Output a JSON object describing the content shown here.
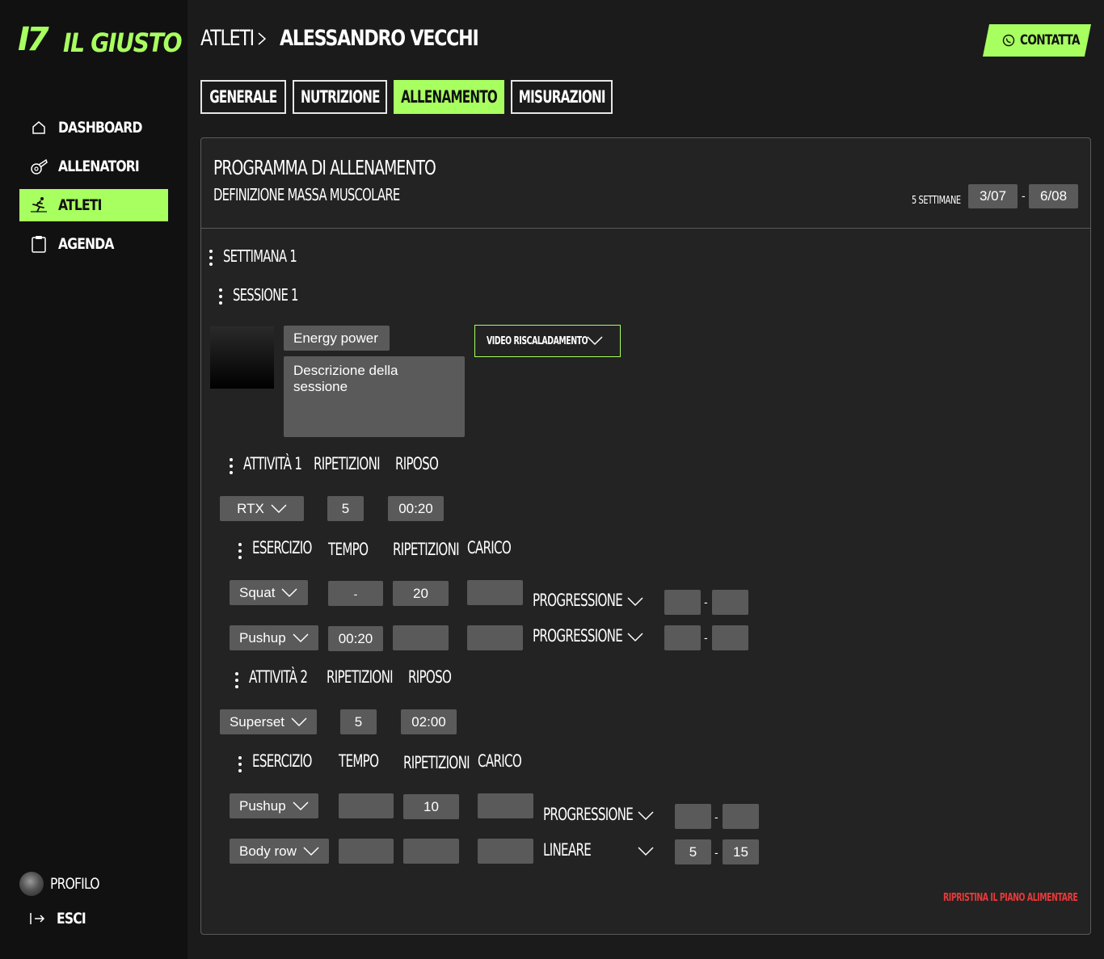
{
  "brand": {
    "mark": "I7",
    "name": "IL GIUSTO"
  },
  "sidebar": {
    "items": [
      {
        "label": "DASHBOARD",
        "icon": "home-icon",
        "active": false
      },
      {
        "label": "ALLENATORI",
        "icon": "whistle-icon",
        "active": false
      },
      {
        "label": "ATLETI",
        "icon": "runner-icon",
        "active": true
      },
      {
        "label": "AGENDA",
        "icon": "clipboard-icon",
        "active": false
      }
    ],
    "profile_label": "PROFILO",
    "logout_label": "ESCI"
  },
  "header": {
    "breadcrumb_root": "ATLETI",
    "breadcrumb_current": "ALESSANDRO VECCHI",
    "contact_label": "CONTATTA"
  },
  "tabs": [
    {
      "label": "GENERALE",
      "active": false
    },
    {
      "label": "NUTRIZIONE",
      "active": false
    },
    {
      "label": "ALLENAMENTO",
      "active": true
    },
    {
      "label": "MISURAZIONI",
      "active": false
    }
  ],
  "program": {
    "title": "PROGRAMMA DI ALLENAMENTO",
    "subtitle": "DEFINIZIONE MASSA MUSCOLARE",
    "weeks_label": "5 SETTIMANE",
    "start_date": "3/07",
    "date_separator": "-",
    "end_date": "6/08"
  },
  "week": {
    "label": "SETTIMANA 1",
    "session": {
      "label": "SESSIONE 1",
      "name": "Energy power",
      "description_placeholder": "Descrizione della sessione",
      "video_label": "VIDEO RISCALADAMENTO",
      "activities": [
        {
          "label": "ATTIVITÀ 1",
          "reps_header": "RIPETIZIONI",
          "rest_header": "RIPOSO",
          "type": "RTX",
          "reps": "5",
          "rest": "00:20",
          "exercise_headers": {
            "exercise": "ESERCIZIO",
            "time": "TEMPO",
            "reps": "RIPETIZIONI",
            "load": "CARICO"
          },
          "exercises": [
            {
              "name": "Squat",
              "time": "-",
              "reps": "20",
              "load": "",
              "progression": "PROGRESSIONE",
              "range_from": "",
              "range_to": ""
            },
            {
              "name": "Pushup",
              "time": "00:20",
              "reps": "",
              "load": "",
              "progression": "PROGRESSIONE",
              "range_from": "",
              "range_to": ""
            }
          ]
        },
        {
          "label": "ATTIVITÀ 2",
          "reps_header": "RIPETIZIONI",
          "rest_header": "RIPOSO",
          "type": "Superset",
          "reps": "5",
          "rest": "02:00",
          "exercise_headers": {
            "exercise": "ESERCIZIO",
            "time": "TEMPO",
            "reps": "RIPETIZIONI",
            "load": "CARICO"
          },
          "exercises": [
            {
              "name": "Pushup",
              "time": "",
              "reps": "10",
              "load": "",
              "progression": "PROGRESSIONE",
              "range_from": "",
              "range_to": ""
            },
            {
              "name": "Body row",
              "time": "",
              "reps": "",
              "load": "",
              "progression": "LINEARE",
              "range_from": "5",
              "range_to": "15"
            }
          ]
        }
      ]
    }
  },
  "range_separator": "-",
  "reset_label": "RIPRISTINA IL PIANO ALIMENTARE",
  "colors": {
    "accent": "#a8ff60",
    "danger": "#e83a3a",
    "field": "#5a5a5a",
    "sidebar": "#111111",
    "background": "#1b1b1b"
  }
}
